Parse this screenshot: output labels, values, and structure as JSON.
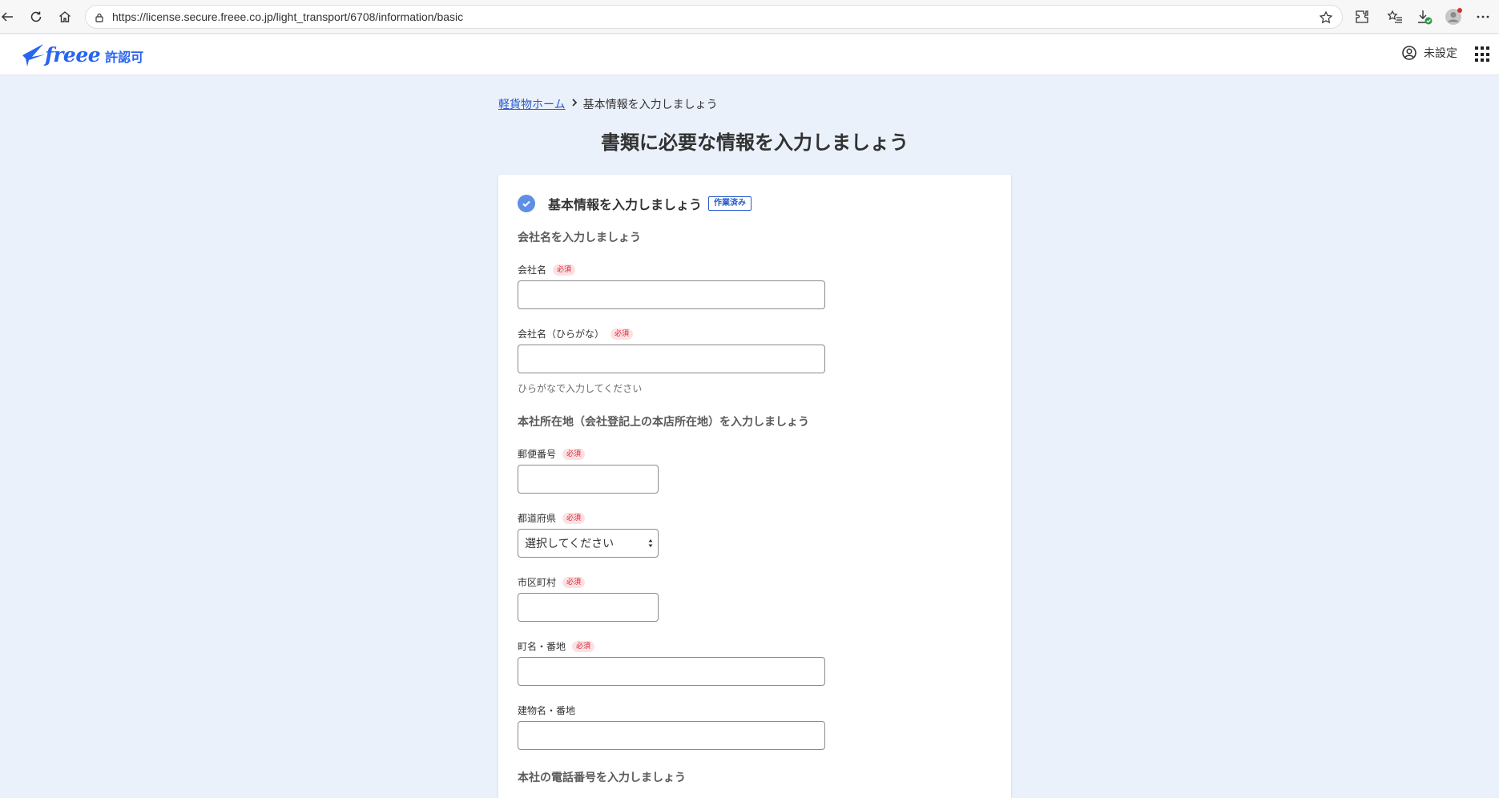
{
  "browser": {
    "url": "https://license.secure.freee.co.jp/light_transport/6708/information/basic"
  },
  "header": {
    "brand": "freee",
    "product": "許認可",
    "user_label": "未設定"
  },
  "breadcrumb": {
    "home_link": "軽貨物ホーム",
    "current": "基本情報を入力しましょう"
  },
  "page_title": "書類に必要な情報を入力しましょう",
  "card": {
    "title": "基本情報を入力しましょう",
    "status_badge": "作業済み",
    "required_label": "必須",
    "sections": {
      "company": "会社名を入力しましょう",
      "address": "本社所在地（会社登記上の本店所在地）を入力しましょう",
      "phone": "本社の電話番号を入力しましょう"
    },
    "fields": {
      "company_name": {
        "label": "会社名",
        "value": ""
      },
      "company_kana": {
        "label": "会社名（ひらがな）",
        "value": "",
        "help": "ひらがなで入力してください"
      },
      "postal_code": {
        "label": "郵便番号",
        "value": ""
      },
      "prefecture": {
        "label": "都道府県",
        "selected": "選択してください"
      },
      "city": {
        "label": "市区町村",
        "value": ""
      },
      "street": {
        "label": "町名・番地",
        "value": ""
      },
      "building": {
        "label": "建物名・番地",
        "value": ""
      }
    }
  }
}
